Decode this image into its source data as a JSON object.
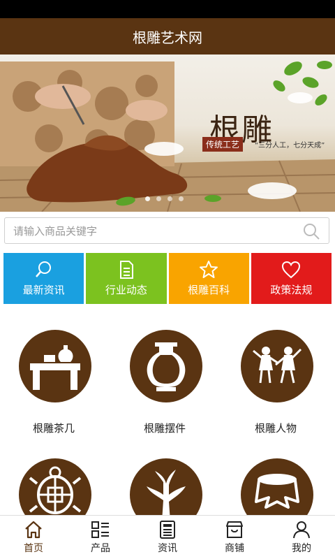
{
  "app": {
    "title": "根雕艺术网"
  },
  "banner": {
    "title": "根雕",
    "tag_primary": "传统工艺",
    "tag_secondary": "“三分人工，七分天成”",
    "dots": 4,
    "active_dot": 0
  },
  "search": {
    "placeholder": "请输入商品关键字"
  },
  "tiles": [
    {
      "label": "最新资讯",
      "icon": "search-icon",
      "color": "#1aa0e0"
    },
    {
      "label": "行业动态",
      "icon": "document-icon",
      "color": "#7cc21f"
    },
    {
      "label": "根雕百科",
      "icon": "star-icon",
      "color": "#f9a400"
    },
    {
      "label": "政策法规",
      "icon": "heart-icon",
      "color": "#e21b1b"
    }
  ],
  "categories": [
    {
      "label": "根雕茶几",
      "icon": "tea-table-icon"
    },
    {
      "label": "根雕摆件",
      "icon": "vase-icon"
    },
    {
      "label": "根雕人物",
      "icon": "dancers-icon"
    },
    {
      "label": "",
      "icon": "turtle-icon"
    },
    {
      "label": "",
      "icon": "tree-root-icon"
    },
    {
      "label": "",
      "icon": "stump-stool-icon"
    }
  ],
  "tabbar": [
    {
      "label": "首页",
      "icon": "home-icon",
      "active": true
    },
    {
      "label": "产品",
      "icon": "grid-list-icon",
      "active": false
    },
    {
      "label": "资讯",
      "icon": "news-icon",
      "active": false
    },
    {
      "label": "商铺",
      "icon": "shop-icon",
      "active": false
    },
    {
      "label": "我的",
      "icon": "user-icon",
      "active": false
    }
  ],
  "colors": {
    "brand": "#5a3412",
    "status_bar": "#000000"
  }
}
